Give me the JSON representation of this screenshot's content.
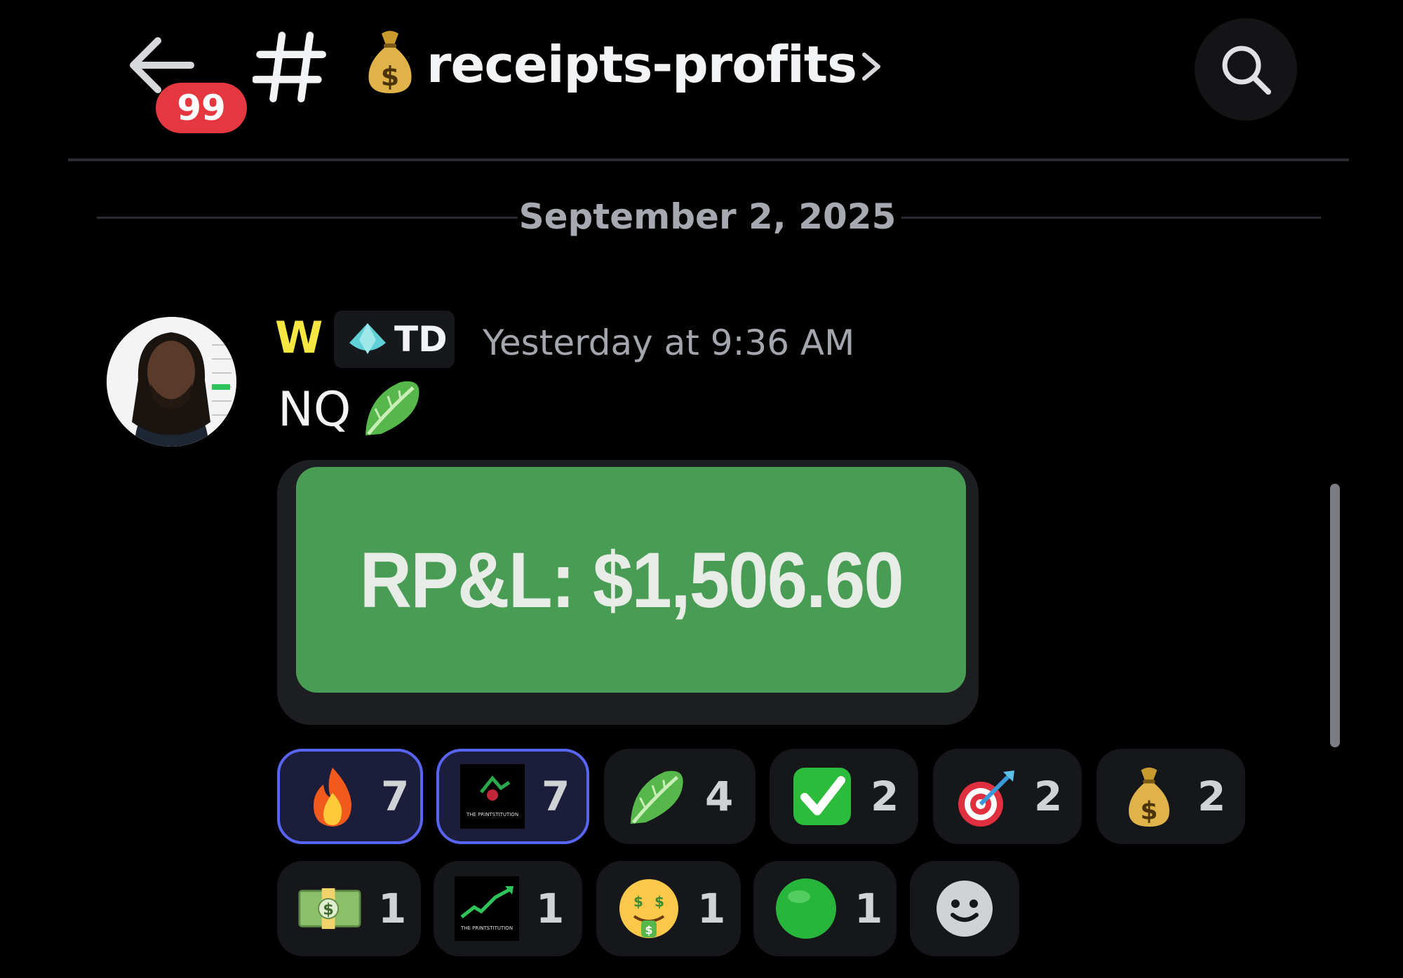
{
  "header": {
    "unread_badge": "99",
    "channel_name": "receipts-profits",
    "icons": [
      "back-arrow-icon",
      "hash-icon",
      "money-bag-icon",
      "chevron-right-icon",
      "search-icon"
    ]
  },
  "divider": {
    "date": "September 2, 2025"
  },
  "message": {
    "author": "W",
    "role_tag": "TD",
    "timestamp": "Yesterday at 9:36 AM",
    "text": "NQ",
    "text_emoji": "leafy-green-icon",
    "embed": {
      "text": "RP&L: $1,506.60",
      "bg_color": "#489c54"
    }
  },
  "reactions": [
    {
      "emoji": "fire-icon",
      "count": "7",
      "selected": true
    },
    {
      "emoji": "printstitution-logo",
      "count": "7",
      "selected": true,
      "logo_text": "THE PRINTSTITUTION"
    },
    {
      "emoji": "leafy-green-icon",
      "count": "4",
      "selected": false
    },
    {
      "emoji": "check-mark-button-icon",
      "count": "2",
      "selected": false
    },
    {
      "emoji": "direct-hit-icon",
      "count": "2",
      "selected": false
    },
    {
      "emoji": "money-bag-icon",
      "count": "2",
      "selected": false
    },
    {
      "emoji": "dollar-banknote-icon",
      "count": "1",
      "selected": false
    },
    {
      "emoji": "printstitution-chart-logo",
      "count": "1",
      "selected": false,
      "logo_text": "THE PRINTSTITUTION"
    },
    {
      "emoji": "money-mouth-face-icon",
      "count": "1",
      "selected": false
    },
    {
      "emoji": "green-circle-icon",
      "count": "1",
      "selected": false
    },
    {
      "emoji": "add-reaction-icon",
      "count": "",
      "selected": false
    }
  ],
  "colors": {
    "author": "#f5e642",
    "badge": "#e5373f",
    "selected_border": "#5865f2"
  }
}
